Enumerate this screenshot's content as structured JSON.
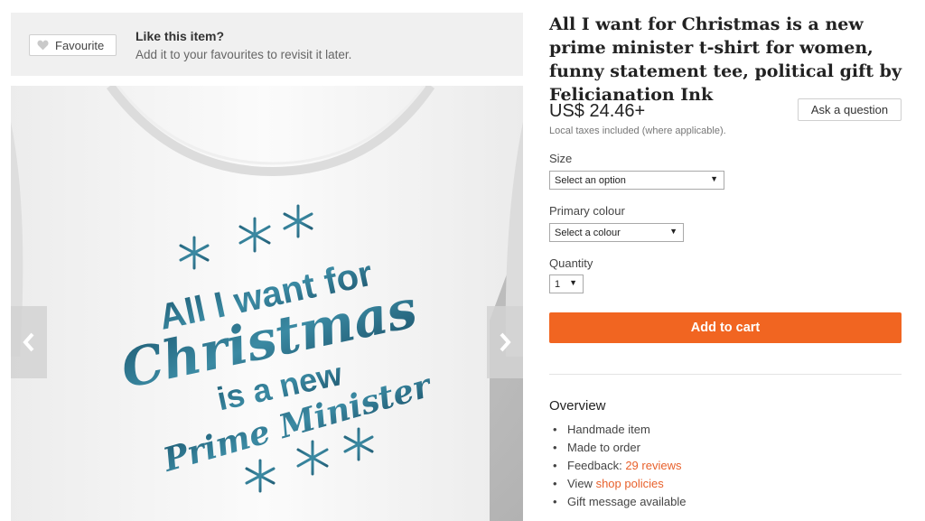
{
  "favourite": {
    "button_label": "Favourite",
    "title": "Like this item?",
    "subtitle": "Add it to your favourites to revisit it later."
  },
  "product": {
    "title": "All I want for Christmas is a new prime minister t-shirt for women, funny statement tee, political gift by Felicianation Ink",
    "price": "US$ 24.46+",
    "tax_note": "Local taxes included (where applicable).",
    "ask_button": "Ask a question"
  },
  "options": {
    "size_label": "Size",
    "size_value": "Select an option",
    "colour_label": "Primary colour",
    "colour_value": "Select a colour",
    "quantity_label": "Quantity",
    "quantity_value": "1"
  },
  "add_to_cart": "Add to cart",
  "overview": {
    "title": "Overview",
    "items": [
      {
        "text": "Handmade item"
      },
      {
        "text": "Made to order"
      },
      {
        "text": "Feedback: ",
        "link": "29 reviews"
      },
      {
        "text": "View ",
        "link": "shop policies"
      },
      {
        "text": "Gift message available"
      }
    ]
  },
  "image": {
    "shirt_text": [
      "All I want for",
      "Christmas",
      "is a new",
      "Prime Minister"
    ],
    "shirt_text_color": "#2d6f86",
    "shirt_color": "#f7f7f7",
    "background_color": "#bdbdbd"
  },
  "colors": {
    "accent": "#f16521",
    "link": "#e8612c"
  }
}
